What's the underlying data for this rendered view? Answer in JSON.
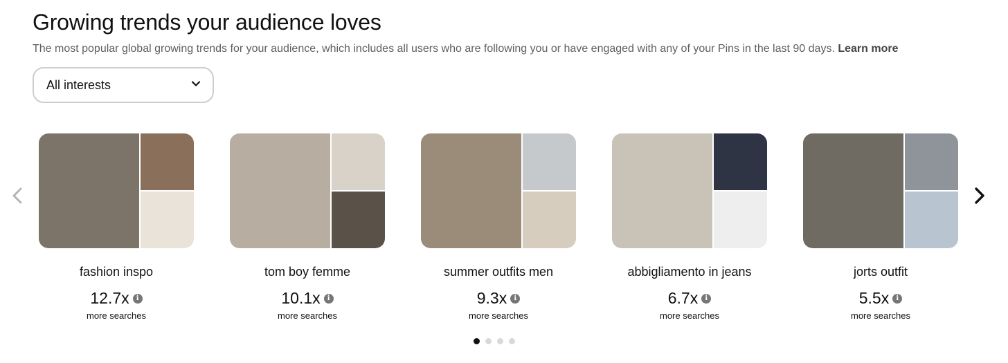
{
  "header": {
    "title": "Growing trends your audience loves",
    "subtitle": "The most popular global growing trends for your audience, which includes all users who are following you or have engaged with any of your Pins in the last 90 days.",
    "learn_more": "Learn more"
  },
  "filter": {
    "selected": "All interests"
  },
  "carousel": {
    "prev_icon": "chevron-left-icon",
    "next_icon": "chevron-right-icon",
    "cards": [
      {
        "name": "fashion inspo",
        "value": "12.7x",
        "sub": "more searches",
        "colors": {
          "main": "#7c7468",
          "tr": "#8a6f5a",
          "br": "#e9e3da"
        }
      },
      {
        "name": "tom boy femme",
        "value": "10.1x",
        "sub": "more searches",
        "colors": {
          "main": "#b7ada0",
          "tr": "#d8d2c8",
          "br": "#5a5248"
        }
      },
      {
        "name": "summer outfits men",
        "value": "9.3x",
        "sub": "more searches",
        "colors": {
          "main": "#9a8c78",
          "tr": "#c5c9cc",
          "br": "#d6cdbf"
        }
      },
      {
        "name": "abbigliamento in jeans",
        "value": "6.7x",
        "sub": "more searches",
        "colors": {
          "main": "#c9c2b6",
          "tr": "#2f3444",
          "br": "#eeeeee"
        }
      },
      {
        "name": "jorts outfit",
        "value": "5.5x",
        "sub": "more searches",
        "colors": {
          "main": "#6f6a62",
          "tr": "#8f949a",
          "br": "#b9c4d1"
        }
      }
    ],
    "pagination": {
      "pages": 4,
      "active": 1
    }
  }
}
